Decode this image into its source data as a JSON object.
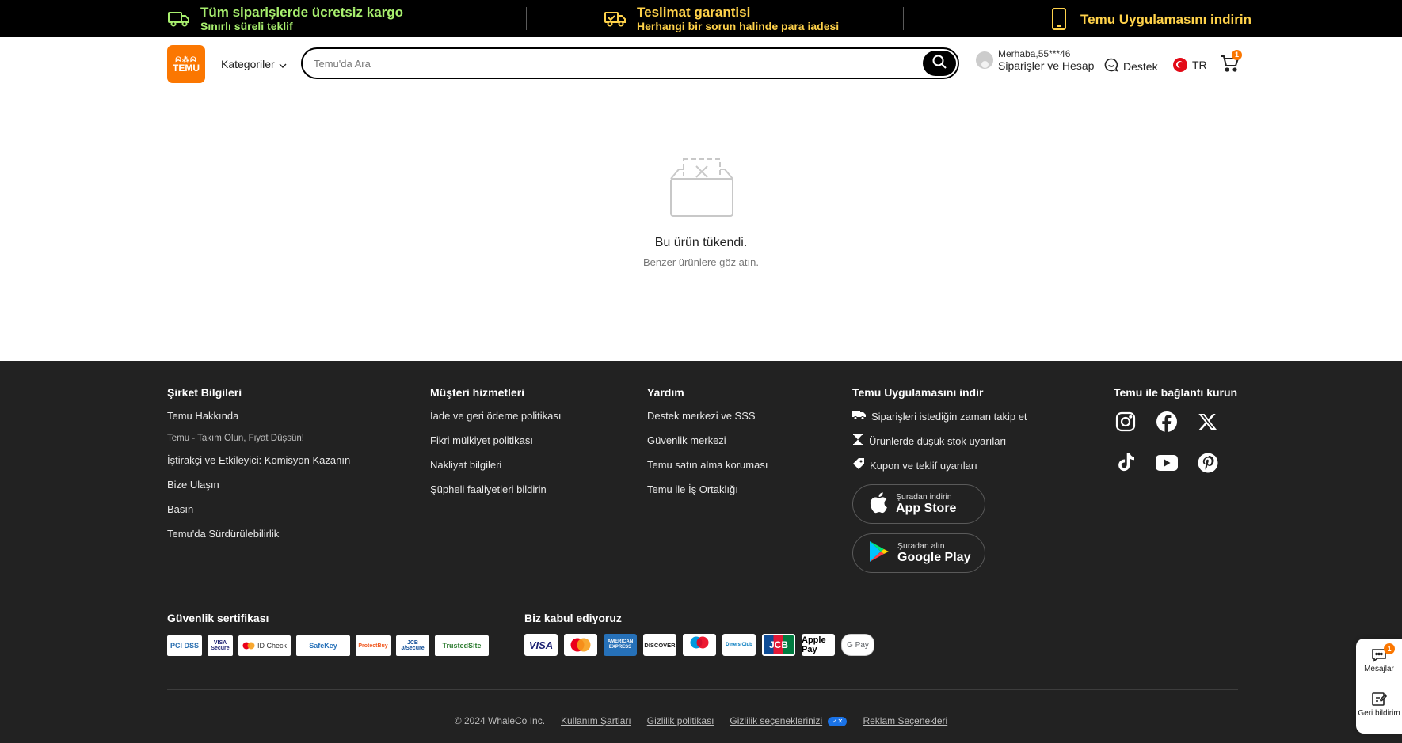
{
  "promo": {
    "left_title": "Tüm siparişlerde ücretsiz kargo",
    "left_sub": "Sınırlı süreli teklif",
    "mid_title": "Teslimat garantisi",
    "mid_sub": "Herhangi bir sorun halinde para iadesi",
    "right_title": "Temu Uygulamasını indirin",
    "colors": {
      "green": "#a8ef6e",
      "yellow": "#ffd24a"
    }
  },
  "header": {
    "logo_top": "ᗣ⁂ᗣ",
    "logo_bottom": "TEMU",
    "categories": "Kategoriler",
    "search_placeholder": "Temu'da Ara",
    "account_hello": "Merhaba,55***46",
    "account_main": "Siparişler ve Hesap",
    "support": "Destek",
    "language": "TR",
    "cart_count": "1",
    "brand_color": "#fb7701"
  },
  "empty": {
    "title": "Bu ürün tükendi.",
    "subtitle": "Benzer ürünlere göz atın."
  },
  "footer": {
    "company": {
      "title": "Şirket Bilgileri",
      "links": [
        "Temu Hakkında",
        "Temu - Takım Olun, Fiyat Düşsün!",
        "İştirakçi ve Etkileyici: Komisyon Kazanın",
        "Bize Ulaşın",
        "Basın",
        "Temu'da Sürdürülebilirlik"
      ]
    },
    "customer": {
      "title": "Müşteri hizmetleri",
      "links": [
        "İade ve geri ödeme politikası",
        "Fikri mülkiyet politikası",
        "Nakliyat bilgileri",
        "Şüpheli faaliyetleri bildirin"
      ]
    },
    "help": {
      "title": "Yardım",
      "links": [
        "Destek merkezi ve SSS",
        "Güvenlik merkezi",
        "Temu satın alma koruması",
        "Temu ile İş Ortaklığı"
      ]
    },
    "app": {
      "title": "Temu Uygulamasını indir",
      "features": [
        "Siparişleri istediğin zaman takip et",
        "Ürünlerde düşük stok uyarıları",
        "Kupon ve teklif uyarıları"
      ],
      "appstore_small": "Şuradan indirin",
      "appstore_big": "App Store",
      "googleplay_small": "Şuradan alın",
      "googleplay_big": "Google Play"
    },
    "connect": {
      "title": "Temu ile bağlantı kurun",
      "icons": [
        "instagram-icon",
        "facebook-icon",
        "x-icon",
        "tiktok-icon",
        "youtube-icon",
        "pinterest-icon"
      ]
    },
    "security_title": "Güvenlik sertifikası",
    "certs": [
      "PCI DSS",
      "VISA Secure",
      "ID Check",
      "SafeKey",
      "ProtectBuy",
      "JCB J/Secure",
      "TrustedSite"
    ],
    "payments_title": "Biz kabul ediyoruz",
    "payments": [
      "VISA",
      "Mastercard",
      "AMERICAN EXPRESS",
      "DISCOVER",
      "maestro",
      "Diners Club",
      "JCB",
      "Apple Pay",
      "G Pay"
    ],
    "copyright": "© 2024 WhaleCo Inc.",
    "terms": "Kullanım Şartları",
    "privacy": "Gizlilik politikası",
    "privacy_choices": "Gizlilik seçeneklerinizi",
    "ad_choices": "Reklam Seçenekleri"
  },
  "side": {
    "messages": "Mesajlar",
    "messages_count": "1",
    "feedback": "Geri bildirim"
  }
}
